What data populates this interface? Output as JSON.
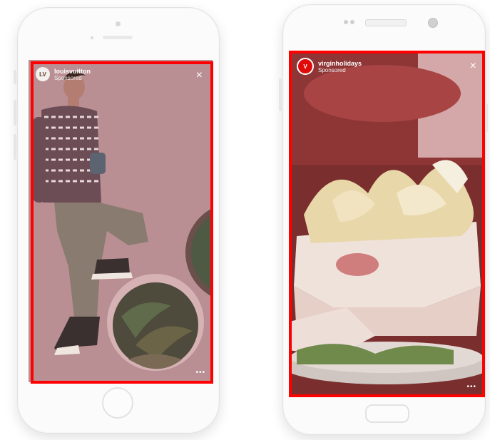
{
  "left_story": {
    "account": "louisvuitton",
    "sponsored": "Sponsored",
    "logo_text": "LV",
    "close": "×",
    "more": "•••"
  },
  "right_story": {
    "account": "virginholidays",
    "sponsored": "Sponsored",
    "logo_text": "V",
    "close": "×",
    "more": "•••"
  },
  "colors": {
    "highlight": "#ff0000",
    "lv_tint": "#b68c90",
    "virgin_tint": "#8a3b3b"
  }
}
